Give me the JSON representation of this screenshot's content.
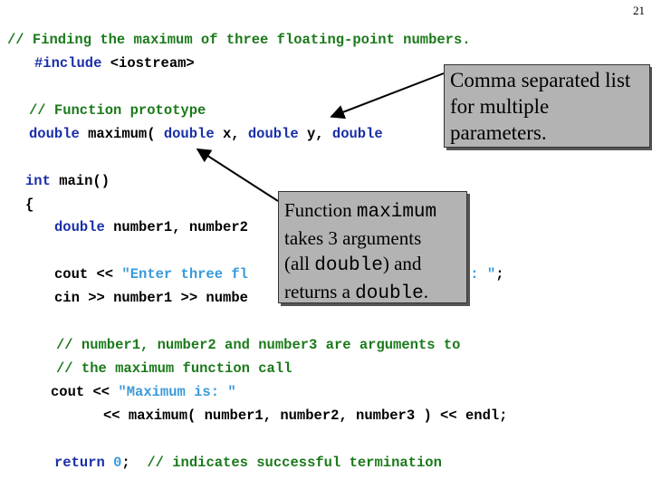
{
  "slide_number": "21",
  "code": {
    "l1": "// Finding the maximum of three floating-point numbers.",
    "l2_kw": "#include",
    "l2_rest": " <iostream>",
    "l3": "// Function prototype",
    "l4_kw1": "double",
    "l4_a": " maximum( ",
    "l4_kw2": "double",
    "l4_b": " x, ",
    "l4_kw3": "double",
    "l4_c": " y, ",
    "l4_kw4": "double",
    "l5_kw": "int",
    "l5_rest": " main()",
    "l6": "{",
    "l7_kw": "double",
    "l7_rest": " number1, number2",
    "l8_a": "cout << ",
    "l8_str": "\"Enter three fl",
    "l8_str2": "s: \"",
    "l8_end": ";",
    "l9": "cin >> number1 >> numbe",
    "l10": "// number1, number2 and number3 are arguments to",
    "l11": "// the maximum function call",
    "l12_a": "cout << ",
    "l12_str": "\"Maximum is: \"",
    "l13": "<< maximum( number1, number2, number3 ) << endl;",
    "l14_kw": "return",
    "l14_num": " 0",
    "l14_semi": ";",
    "l14_cm": "  // indicates successful termination"
  },
  "callouts": {
    "c1_line1": "Comma separated list",
    "c1_line2": "for multiple",
    "c1_line3": "parameters.",
    "c2_t1": "Function ",
    "c2_m1": "maximum",
    "c2_t2": "takes 3 arguments",
    "c2_t3a": "(all ",
    "c2_m2": "double",
    "c2_t3b": ") and",
    "c2_t4a": "returns a ",
    "c2_m3": "double",
    "c2_t4b": "."
  }
}
